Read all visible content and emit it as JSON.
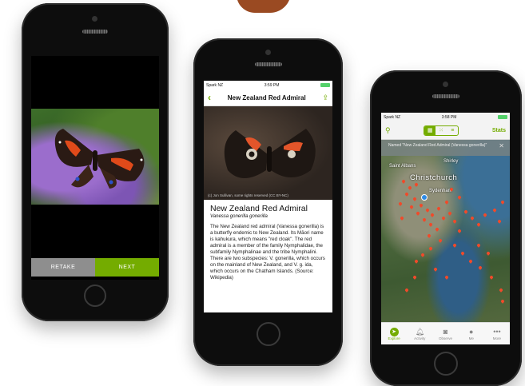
{
  "phone1": {
    "retake_label": "RETAKE",
    "next_label": "NEXT"
  },
  "phone2": {
    "status": {
      "carrier": "Spark NZ",
      "time": "3:59 PM"
    },
    "nav_title": "New Zealand Red Admiral",
    "photo_credit": "(c) Jon Sullivan, some rights reserved (CC BY-NC)",
    "common_name": "New Zealand Red Admiral",
    "scientific_name": "Vanessa gonerilla gonerilla",
    "description": "The New Zealand red admiral (Vanessa gonerilla) is a butterfly endemic to New Zealand. Its Māori name is kahukura, which means \"red cloak\". The red admiral is a member of the family Nymphalidae, the subfamily Nymphalinae and the tribe Nymphalini. There are two subspecies: V. gonerilla, which occurs on the mainland of New Zealand, and V. g. ida, which occurs on the Chatham Islands. (Source: Wikipedia)"
  },
  "phone3": {
    "status": {
      "carrier": "Spark NZ",
      "time": "3:58 PM"
    },
    "stats_label": "Stats",
    "notice": "Named \"New Zealand Red Admiral (Vanessa gonerilla)\"",
    "map_labels": {
      "saint_albans": "Saint Albans",
      "shirley": "Shirley",
      "christchurch": "Christchurch",
      "sydenham": "Sydenham"
    },
    "tabs": [
      "Explore",
      "Activity",
      "Observe",
      "Me",
      "More"
    ],
    "accent": "#74ac00"
  }
}
